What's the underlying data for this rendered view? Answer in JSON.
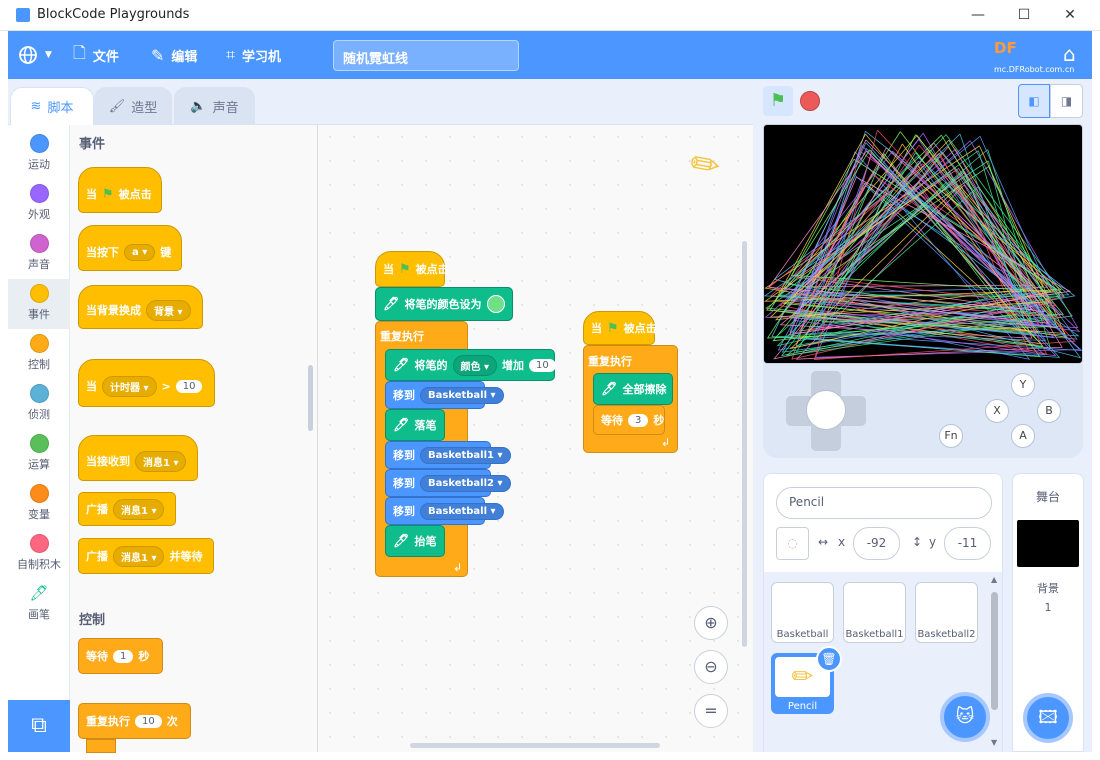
{
  "window": {
    "title": "BlockCode Playgrounds",
    "minimize": "—",
    "maximize": "☐",
    "close": "✕"
  },
  "menubar": {
    "language_icon": "globe-icon",
    "file": "文件",
    "edit": "编辑",
    "learn": "学习机",
    "project_title": "随机霓虹线",
    "logo": "DF",
    "logo_url": "mc.DFRobot.com.cn"
  },
  "tabs": {
    "code": "脚本",
    "costumes": "造型",
    "sounds": "声音"
  },
  "categories": [
    {
      "label": "运动",
      "color": "#4c97ff"
    },
    {
      "label": "外观",
      "color": "#9966ff"
    },
    {
      "label": "声音",
      "color": "#cf63cf"
    },
    {
      "label": "事件",
      "color": "#ffbf00"
    },
    {
      "label": "控制",
      "color": "#ffab19"
    },
    {
      "label": "侦测",
      "color": "#5cb1d6"
    },
    {
      "label": "运算",
      "color": "#59c059"
    },
    {
      "label": "变量",
      "color": "#ff8c1a"
    },
    {
      "label": "自制积木",
      "color": "#ff6680"
    },
    {
      "label": "画笔",
      "color": "#0fbd8c"
    }
  ],
  "palette": {
    "events_title": "事件",
    "when_flag_pre": "当",
    "when_flag_post": "被点击",
    "when_key_pre": "当按下",
    "when_key_value": "a",
    "when_key_post": "键",
    "when_backdrop": "当背景换成",
    "backdrop_value": "背景",
    "when_timer_pre": "当",
    "timer_value": "计时器",
    "timer_op": ">",
    "timer_num": "10",
    "when_receive": "当接收到",
    "message_value": "消息1",
    "broadcast": "广播",
    "broadcast_value": "消息1",
    "broadcast_wait": "广播",
    "broadcast_wait_value": "消息1",
    "broadcast_wait_post": "并等待",
    "control_title": "控制",
    "wait_pre": "等待",
    "wait_value": "1",
    "wait_post": "秒",
    "repeat_pre": "重复执行",
    "repeat_value": "10",
    "repeat_post": "次"
  },
  "script1": {
    "hat_pre": "当",
    "hat_post": "被点击",
    "set_color": "将笔的颜色设为",
    "forever": "重复执行",
    "change_pen": "将笔的",
    "change_param": "颜色",
    "change_by": "增加",
    "change_value": "10",
    "goto1": "移到",
    "goto1_target": "Basketball",
    "pen_down": "落笔",
    "goto2": "移到",
    "goto2_target": "Basketball1",
    "goto3": "移到",
    "goto3_target": "Basketball2",
    "goto4": "移到",
    "goto4_target": "Basketball",
    "pen_up": "抬笔"
  },
  "script2": {
    "hat_pre": "当",
    "hat_post": "被点击",
    "forever": "重复执行",
    "clear": "全部擦除",
    "wait_pre": "等待",
    "wait_value": "3",
    "wait_post": "秒"
  },
  "gamepad": {
    "y": "Y",
    "x": "X",
    "b": "B",
    "a": "A",
    "fn": "Fn"
  },
  "sprite_info": {
    "name": "Pencil",
    "x_label": "x",
    "x_value": "-92",
    "y_label": "y",
    "y_value": "-11"
  },
  "sprites": [
    "Basketball",
    "Basketball1",
    "Basketball2",
    "Pencil"
  ],
  "stage_panel": {
    "title": "舞台",
    "backdrops_label": "背景",
    "backdrops_count": "1"
  },
  "colors": {
    "accent": "#4c97ff",
    "events": "#ffbf00",
    "control": "#ffab19",
    "pen": "#0fbd8c",
    "motion": "#4c97ff"
  }
}
